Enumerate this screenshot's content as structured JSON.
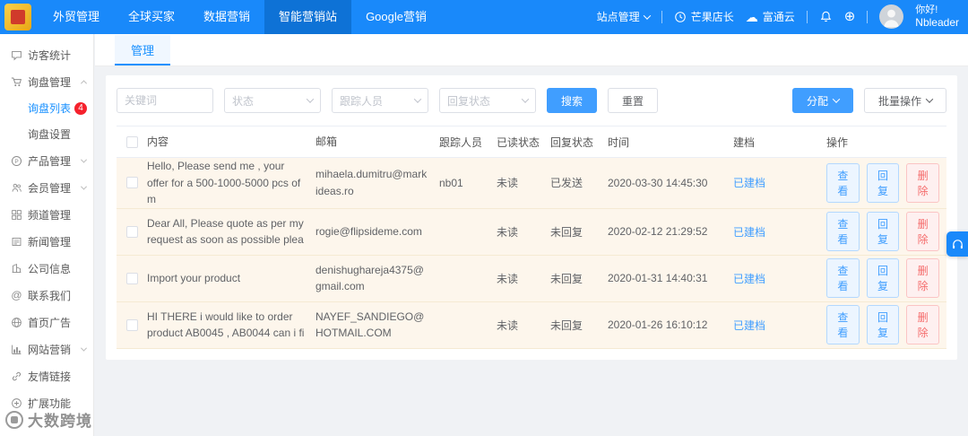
{
  "colors": {
    "accent": "#1890ff",
    "topbar": "#1989fa",
    "danger": "#f56c6c",
    "row_highlight": "#fdf6ec",
    "badge": "#f5222d"
  },
  "topbar": {
    "nav_items": [
      {
        "label": "外贸管理"
      },
      {
        "label": "全球买家"
      },
      {
        "label": "数据营销"
      },
      {
        "label": "智能营销站"
      },
      {
        "label": "Google营销"
      }
    ],
    "site_manage_label": "站点管理",
    "mango_label": "芒果店长",
    "cloud_label": "富通云",
    "greeting": "你好!",
    "username": "Nbleader"
  },
  "sidebar": {
    "items": [
      {
        "label": "访客统计"
      },
      {
        "label": "询盘管理"
      },
      {
        "label": "询盘列表",
        "badge": "4"
      },
      {
        "label": "询盘设置"
      },
      {
        "label": "产品管理"
      },
      {
        "label": "会员管理"
      },
      {
        "label": "频道管理"
      },
      {
        "label": "新闻管理"
      },
      {
        "label": "公司信息"
      },
      {
        "label": "联系我们"
      },
      {
        "label": "首页广告"
      },
      {
        "label": "网站营销"
      },
      {
        "label": "友情链接"
      },
      {
        "label": "扩展功能"
      }
    ]
  },
  "main": {
    "tab_label": "管理",
    "filters": {
      "keyword_placeholder": "关键词",
      "status_placeholder": "状态",
      "tracker_placeholder": "跟踪人员",
      "reply_placeholder": "回复状态",
      "search_label": "搜索",
      "reset_label": "重置",
      "assign_label": "分配",
      "batch_label": "批量操作"
    },
    "table": {
      "headers": [
        "内容",
        "邮箱",
        "跟踪人员",
        "已读状态",
        "回复状态",
        "时间",
        "建档",
        "操作"
      ],
      "actions": {
        "view": "查看",
        "reply": "回复",
        "delete": "删除"
      },
      "rows": [
        {
          "content": "Hello, Please send me , your offer for a 500-1000-5000 pcs of m",
          "email": "mihaela.dumitru@markideas.ro",
          "tracker": "nb01",
          "read_status": "未读",
          "reply_status": "已发送",
          "time": "2020-03-30 14:45:30",
          "archive": "已建档"
        },
        {
          "content": "Dear All, Please quote as per my request as soon as possible plea",
          "email": "rogie@flipsideme.com",
          "tracker": "",
          "read_status": "未读",
          "reply_status": "未回复",
          "time": "2020-02-12 21:29:52",
          "archive": "已建档"
        },
        {
          "content": "Import your product",
          "email": "denishughareja4375@gmail.com",
          "tracker": "",
          "read_status": "未读",
          "reply_status": "未回复",
          "time": "2020-01-31 14:40:31",
          "archive": "已建档"
        },
        {
          "content": "HI THERE i would like to order product AB0045 , AB0044 can i fi",
          "email": "NAYEF_SANDIEGO@HOTMAIL.COM",
          "tracker": "",
          "read_status": "未读",
          "reply_status": "未回复",
          "time": "2020-01-26 16:10:12",
          "archive": "已建档"
        }
      ]
    }
  },
  "watermark": {
    "text": "大数跨境"
  }
}
